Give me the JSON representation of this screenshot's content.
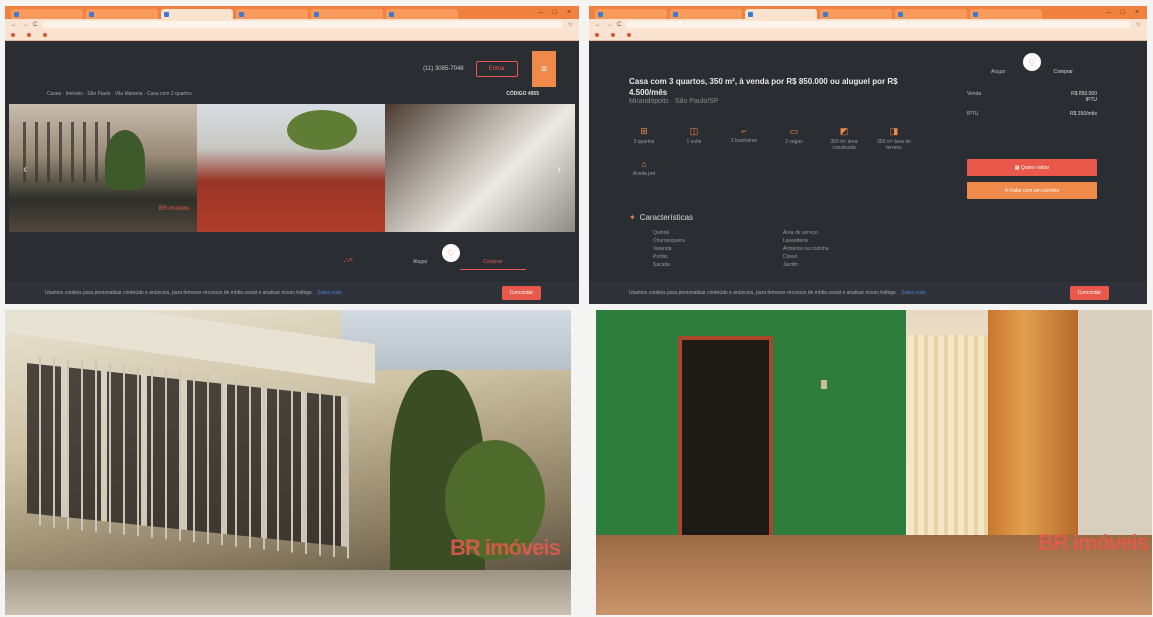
{
  "left_window": {
    "tabs": [
      "",
      "",
      "",
      "",
      "",
      ""
    ],
    "bookmarks": [
      "",
      "",
      ""
    ],
    "header": {
      "logo": "",
      "phone": "(11) 3085-7048",
      "login": "Entrar"
    },
    "breadcrumb": "Casas · Imóveis · São Paulo · Vila Mariana · Casa com 3 quartos",
    "codigo": "CÓDIGO 4955",
    "photo_watermark": "BR imóveis",
    "actions": {
      "alugar": "Alugar",
      "comprar": "Comprar"
    },
    "cookie": {
      "text": "Usamos cookies para personalizar conteúdo e anúncios, para fornecer recursos de mídia social e analisar nosso tráfego.",
      "link": "Saiba mais",
      "button": "Concordar"
    }
  },
  "right_window": {
    "tabs": [
      "",
      "",
      "",
      "",
      "",
      ""
    ],
    "bookmarks": [
      "",
      "",
      ""
    ],
    "title": "Casa com 3 quartos, 350 m², à venda por R$ 850.000 ou aluguel por R$ 4.500/mês",
    "location": "Mirandópolis · São Paulo/SP",
    "panel": {
      "tabs": [
        "Alugar",
        "Comprar"
      ],
      "rows": [
        {
          "label": "Venda",
          "value": "R$ 850.000",
          "sub": "IPTU"
        },
        {
          "label": "IPTU",
          "value": "R$ 350/mês",
          "sub": ""
        }
      ],
      "btn_primary": "Quero visitar",
      "btn_secondary": "Falar com um corretor"
    },
    "features": [
      {
        "icon": "⊞",
        "label": "3 quartos"
      },
      {
        "icon": "◫",
        "label": "1 suíte"
      },
      {
        "icon": "⌐",
        "label": "2 banheiros"
      },
      {
        "icon": "▭",
        "label": "2 vagas"
      },
      {
        "icon": "◩",
        "label": "350 m² área construída"
      },
      {
        "icon": "◨",
        "label": "350 m² área do terreno"
      },
      {
        "icon": "⌂",
        "label": "Aceita pet"
      }
    ],
    "caracteristicas_title": "Características",
    "caracteristicas": [
      "Quintal",
      "Área de serviço",
      "Churrasqueira",
      "Lavanderia",
      "Varanda",
      "Armários na cozinha",
      "Portão",
      "Closet",
      "Sacada",
      "Jardim"
    ],
    "cookie": {
      "text": "Usamos cookies para personalizar conteúdo e anúncios, para fornecer recursos de mídia social e analisar nosso tráfego.",
      "link": "Saiba mais",
      "button": "Concordar"
    }
  },
  "bottom_photos": {
    "left_watermark": {
      "brand": "BR imóveis",
      "tagline": ""
    },
    "right_watermark": {
      "brand": "BR imóveis",
      "tagline": ""
    }
  },
  "colors": {
    "accent": "#e8594b",
    "orange": "#f08a4b",
    "dark": "#2a2d32",
    "chrome": "#f1813e"
  }
}
